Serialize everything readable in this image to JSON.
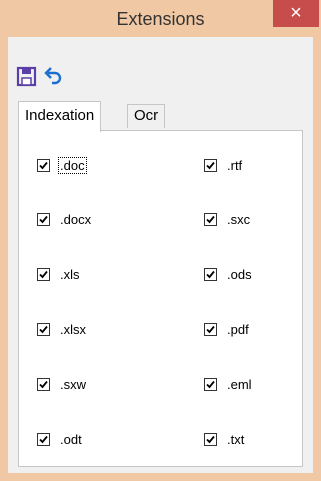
{
  "window": {
    "title": "Extensions",
    "close_symbol": "×"
  },
  "toolbar": {
    "save_icon": "floppy-disk-icon",
    "undo_icon": "undo-arrow-icon"
  },
  "tabs": [
    {
      "label": "Indexation",
      "active": true
    },
    {
      "label": "Ocr",
      "active": false
    }
  ],
  "extensions": {
    "left": [
      {
        "label": ".doc",
        "checked": true,
        "focused": true
      },
      {
        "label": ".docx",
        "checked": true
      },
      {
        "label": ".xls",
        "checked": true
      },
      {
        "label": ".xlsx",
        "checked": true
      },
      {
        "label": ".sxw",
        "checked": true
      },
      {
        "label": ".odt",
        "checked": true
      }
    ],
    "right": [
      {
        "label": ".rtf",
        "checked": true
      },
      {
        "label": ".sxc",
        "checked": true
      },
      {
        "label": ".ods",
        "checked": true
      },
      {
        "label": ".pdf",
        "checked": true
      },
      {
        "label": ".eml",
        "checked": true
      },
      {
        "label": ".txt",
        "checked": true
      }
    ]
  },
  "colors": {
    "frame": "#f0c9a4",
    "close": "#c74c4c",
    "icon": "#5b3fa8"
  }
}
